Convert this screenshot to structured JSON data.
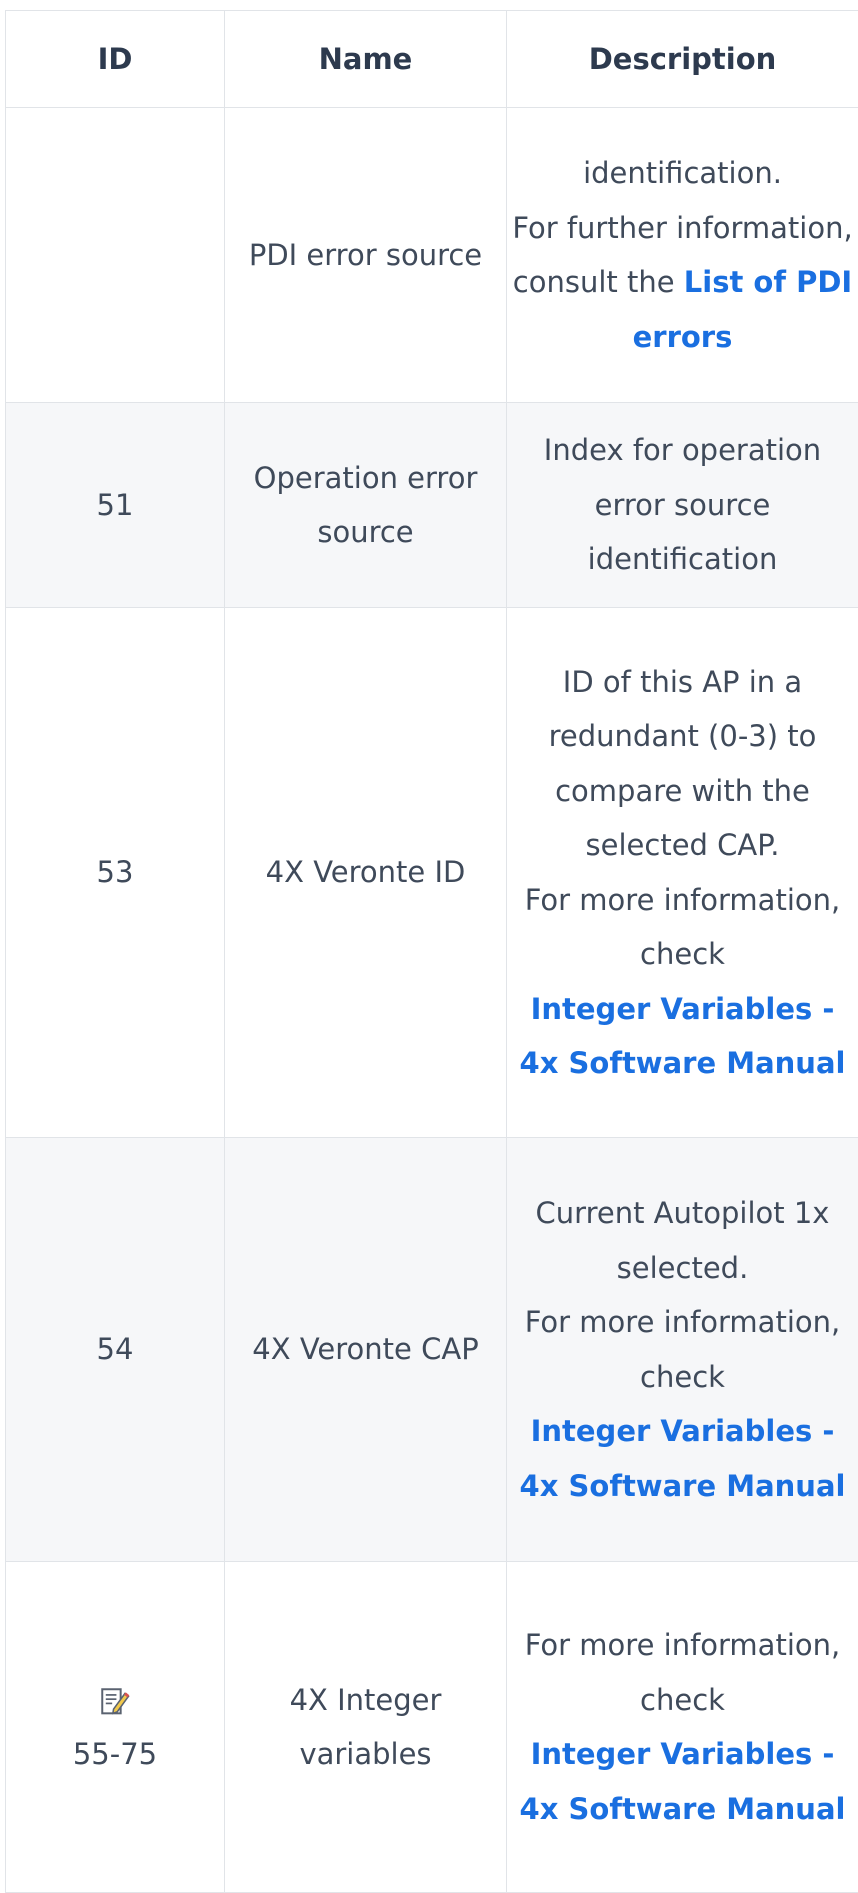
{
  "table": {
    "headers": {
      "id": "ID",
      "name": "Name",
      "description": "Description"
    },
    "rows": [
      {
        "id": "",
        "name": "PDI error source",
        "desc_text": [
          "identification.",
          "For further information, consult the "
        ],
        "desc_link": "List of PDI errors"
      },
      {
        "id": "51",
        "name": "Operation error source",
        "desc_text": [
          "Index for operation error source identification"
        ],
        "desc_link": ""
      },
      {
        "id": "53",
        "name": "4X Veronte ID",
        "desc_text": [
          "ID of this AP in a redundant (0-3) to compare with the selected CAP.",
          "For more information, check"
        ],
        "desc_link": "Integer Variables - 4x Software Manual"
      },
      {
        "id": "54",
        "name": "4X Veronte CAP",
        "desc_text": [
          "Current Autopilot 1x selected.",
          "For more information, check"
        ],
        "desc_link": "Integer Variables - 4x Software Manual"
      },
      {
        "id": "55-75",
        "id_icon": "edit-note-icon",
        "name": "4X Integer variables",
        "desc_text": [
          "For more information, check"
        ],
        "desc_link": "Integer Variables - 4x Software Manual"
      }
    ]
  },
  "colors": {
    "link": "#1a6fe0",
    "text": "#3f4a5a",
    "header_text": "#2d3a4e",
    "border": "#e1e4e8",
    "shaded_row": "#f6f7f9"
  }
}
